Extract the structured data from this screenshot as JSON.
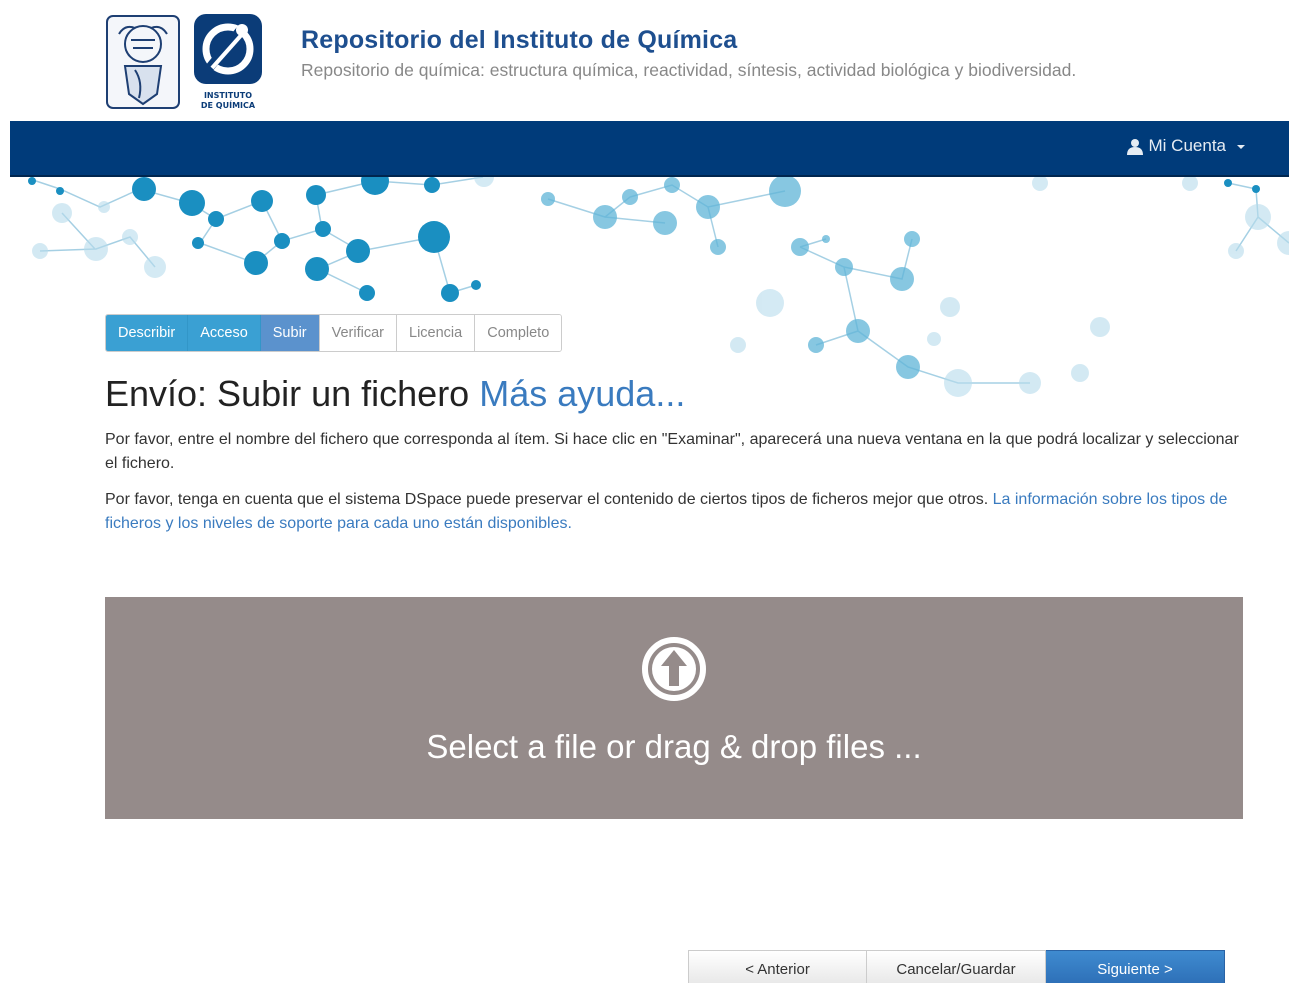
{
  "header": {
    "title": "Repositorio del Instituto de Química",
    "subtitle": "Repositorio de química: estructura química, reactividad, síntesis, actividad biológica y biodiversidad.",
    "logo_iq_text_line1": "INSTITUTO",
    "logo_iq_text_line2": "DE QUÍMICA"
  },
  "navbar": {
    "account_label": "Mi Cuenta",
    "account_icon": "user-icon"
  },
  "steps": [
    {
      "label": "Describir",
      "state": "done"
    },
    {
      "label": "Acceso",
      "state": "done"
    },
    {
      "label": "Subir",
      "state": "current"
    },
    {
      "label": "Verificar",
      "state": "todo"
    },
    {
      "label": "Licencia",
      "state": "todo"
    },
    {
      "label": "Completo",
      "state": "todo"
    }
  ],
  "page": {
    "heading": "Envío: Subir un fichero",
    "help_link": "Más ayuda...",
    "paragraph1": "Por favor, entre el nombre del fichero que corresponda al ítem. Si hace clic en \"Examinar\", aparecerá una nueva ventana en la que podrá localizar y seleccionar el fichero.",
    "paragraph2_text": "Por favor, tenga en cuenta que el sistema DSpace puede preservar el contenido de ciertos tipos de ficheros mejor que otros. ",
    "paragraph2_link": "La información sobre los tipos de ficheros y los niveles de soporte para cada uno están disponibles."
  },
  "dropzone": {
    "label": "Select a file or drag & drop files ...",
    "icon": "upload-arrow-icon"
  },
  "buttons": {
    "previous": "< Anterior",
    "cancel_save": "Cancelar/Guardar",
    "next": "Siguiente >"
  },
  "colors": {
    "navbar": "#003b7a",
    "title": "#1e4f8f",
    "step_done": "#3aa0d3",
    "step_current": "#5b92cd",
    "dropzone": "#958b8a",
    "link": "#3a7bbf"
  }
}
